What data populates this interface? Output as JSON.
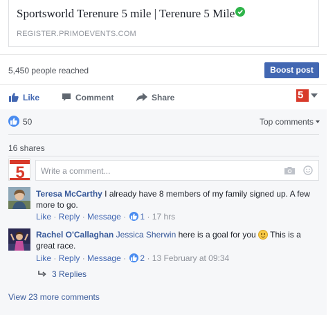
{
  "link_card": {
    "title": "Sportsworld Terenure 5 mile | Terenure 5 Mile",
    "domain": "REGISTER.PRIMOEVENTS.COM"
  },
  "insights": {
    "reach_text": "5,450 people reached",
    "boost_label": "Boost post"
  },
  "actions": {
    "like": "Like",
    "comment": "Comment",
    "share": "Share"
  },
  "page_avatar_text": "5",
  "stats": {
    "likes_count": "50",
    "sort_label": "Top comments",
    "shares_text": "16 shares"
  },
  "composer": {
    "placeholder": "Write a comment..."
  },
  "comments": [
    {
      "author": "Teresa McCarthy",
      "text": " I already have 8 members of my family signed up. A few more to go.",
      "like_label": "Like",
      "reply_label": "Reply",
      "message_label": "Message",
      "likes": "1",
      "time": "17 hrs"
    },
    {
      "author": "Rachel O'Callaghan",
      "tag": "Jessica Sherwin",
      "text_before": " ",
      "text_after": " here is a goal for you ",
      "text_end": " This is a great race.",
      "like_label": "Like",
      "reply_label": "Reply",
      "message_label": "Message",
      "likes": "2",
      "time": "13 February at 09:34",
      "replies": "3 Replies"
    }
  ],
  "view_more": "View 23 more comments",
  "colors": {
    "brand_blue": "#4267b2",
    "link_blue": "#365899",
    "verified_green": "#2fb44a",
    "page_red": "#d83a2b"
  },
  "icons": [
    "verified-check-icon",
    "thumbs-up-icon",
    "comment-icon",
    "share-arrow-icon",
    "camera-icon",
    "smiley-icon",
    "reply-arrow-icon"
  ]
}
